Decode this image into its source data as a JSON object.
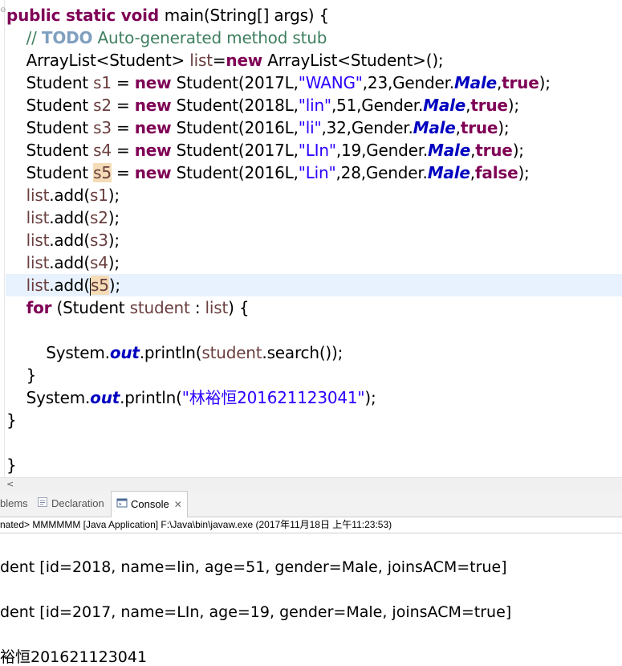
{
  "editor": {
    "lines": [
      [
        {
          "t": "public static void ",
          "c": "kw"
        },
        {
          "t": "main(String[] args) {"
        }
      ],
      [
        {
          "t": "    // ",
          "c": "cm"
        },
        {
          "t": "TODO",
          "c": "todo"
        },
        {
          "t": " Auto-generated method stub",
          "c": "cm"
        }
      ],
      [
        {
          "t": "    ArrayList<Student> "
        },
        {
          "t": "list",
          "c": "var"
        },
        {
          "t": "="
        },
        {
          "t": "new",
          "c": "kw"
        },
        {
          "t": " ArrayList<Student>();"
        }
      ],
      [
        {
          "t": "    Student "
        },
        {
          "t": "s1",
          "c": "var"
        },
        {
          "t": " = "
        },
        {
          "t": "new",
          "c": "kw"
        },
        {
          "t": " Student(2017L,"
        },
        {
          "t": "\"WANG\"",
          "c": "str"
        },
        {
          "t": ",23,Gender."
        },
        {
          "t": "Male",
          "c": "fld"
        },
        {
          "t": ","
        },
        {
          "t": "true",
          "c": "kw"
        },
        {
          "t": ");"
        }
      ],
      [
        {
          "t": "    Student "
        },
        {
          "t": "s2",
          "c": "var"
        },
        {
          "t": " = "
        },
        {
          "t": "new",
          "c": "kw"
        },
        {
          "t": " Student(2018L,"
        },
        {
          "t": "\"lin\"",
          "c": "str"
        },
        {
          "t": ",51,Gender."
        },
        {
          "t": "Male",
          "c": "fld"
        },
        {
          "t": ","
        },
        {
          "t": "true",
          "c": "kw"
        },
        {
          "t": ");"
        }
      ],
      [
        {
          "t": "    Student "
        },
        {
          "t": "s3",
          "c": "var"
        },
        {
          "t": " = "
        },
        {
          "t": "new",
          "c": "kw"
        },
        {
          "t": " Student(2016L,"
        },
        {
          "t": "\"li\"",
          "c": "str"
        },
        {
          "t": ",32,Gender."
        },
        {
          "t": "Male",
          "c": "fld"
        },
        {
          "t": ","
        },
        {
          "t": "true",
          "c": "kw"
        },
        {
          "t": ");"
        }
      ],
      [
        {
          "t": "    Student "
        },
        {
          "t": "s4",
          "c": "var"
        },
        {
          "t": " = "
        },
        {
          "t": "new",
          "c": "kw"
        },
        {
          "t": " Student(2017L,"
        },
        {
          "t": "\"LIn\"",
          "c": "str"
        },
        {
          "t": ",19,Gender."
        },
        {
          "t": "Male",
          "c": "fld"
        },
        {
          "t": ","
        },
        {
          "t": "true",
          "c": "kw"
        },
        {
          "t": ");"
        }
      ],
      [
        {
          "t": "    Student "
        },
        {
          "t": "s5",
          "c": "var occ"
        },
        {
          "t": " = "
        },
        {
          "t": "new",
          "c": "kw"
        },
        {
          "t": " Student(2016L,"
        },
        {
          "t": "\"Lin\"",
          "c": "str"
        },
        {
          "t": ",28,Gender."
        },
        {
          "t": "Male",
          "c": "fld"
        },
        {
          "t": ","
        },
        {
          "t": "false",
          "c": "kw"
        },
        {
          "t": ");"
        }
      ],
      [
        {
          "t": "    "
        },
        {
          "t": "list",
          "c": "var"
        },
        {
          "t": ".add("
        },
        {
          "t": "s1",
          "c": "var"
        },
        {
          "t": ");"
        }
      ],
      [
        {
          "t": "    "
        },
        {
          "t": "list",
          "c": "var"
        },
        {
          "t": ".add("
        },
        {
          "t": "s2",
          "c": "var"
        },
        {
          "t": ");"
        }
      ],
      [
        {
          "t": "    "
        },
        {
          "t": "list",
          "c": "var"
        },
        {
          "t": ".add("
        },
        {
          "t": "s3",
          "c": "var"
        },
        {
          "t": ");"
        }
      ],
      [
        {
          "t": "    "
        },
        {
          "t": "list",
          "c": "var"
        },
        {
          "t": ".add("
        },
        {
          "t": "s4",
          "c": "var"
        },
        {
          "t": ");"
        }
      ],
      [
        {
          "t": "    "
        },
        {
          "t": "list",
          "c": "var"
        },
        {
          "t": ".add("
        },
        {
          "t": "",
          "caret": true
        },
        {
          "t": "s5",
          "c": "var occ"
        },
        {
          "t": ");"
        }
      ],
      [
        {
          "t": "    "
        },
        {
          "t": "for",
          "c": "kw"
        },
        {
          "t": " (Student "
        },
        {
          "t": "student",
          "c": "var"
        },
        {
          "t": " : "
        },
        {
          "t": "list",
          "c": "var"
        },
        {
          "t": ") {"
        }
      ],
      [
        {
          "t": ""
        }
      ],
      [
        {
          "t": "        System."
        },
        {
          "t": "out",
          "c": "fld"
        },
        {
          "t": ".println("
        },
        {
          "t": "student",
          "c": "var"
        },
        {
          "t": ".search());"
        }
      ],
      [
        {
          "t": "    }"
        }
      ],
      [
        {
          "t": "    System."
        },
        {
          "t": "out",
          "c": "fld"
        },
        {
          "t": ".println("
        },
        {
          "t": "\"林裕恒201621123041\"",
          "c": "str"
        },
        {
          "t": ");"
        }
      ],
      [
        {
          "t": "}"
        }
      ],
      [
        {
          "t": ""
        }
      ],
      [
        {
          "t": "}"
        }
      ]
    ]
  },
  "tabs": {
    "problems_label": "blems",
    "declaration_label": "Declaration",
    "console_label": "Console",
    "console_close": "✕"
  },
  "console": {
    "description": "nated> MMMMMM [Java Application] F:\\Java\\bin\\javaw.exe (2017年11月18日 上午11:23:53)",
    "output": [
      "dent [id=2018, name=lin, age=51, gender=Male, joinsACM=true]",
      "",
      "dent [id=2017, name=LIn, age=19, gender=Male, joinsACM=true]",
      "",
      "裕恒201621123041"
    ]
  },
  "icons": {
    "declaration": "declaration-icon",
    "console": "console-icon",
    "scroll_left": "scroll-left-icon"
  },
  "colors": {
    "keyword": "#7f0055",
    "comment": "#3f7f5f",
    "string": "#2a00ff",
    "static_field": "#0000c0",
    "local_variable": "#6a3e3e",
    "current_line": "#e8f2fe",
    "occurrence": "#f4dcb6"
  }
}
